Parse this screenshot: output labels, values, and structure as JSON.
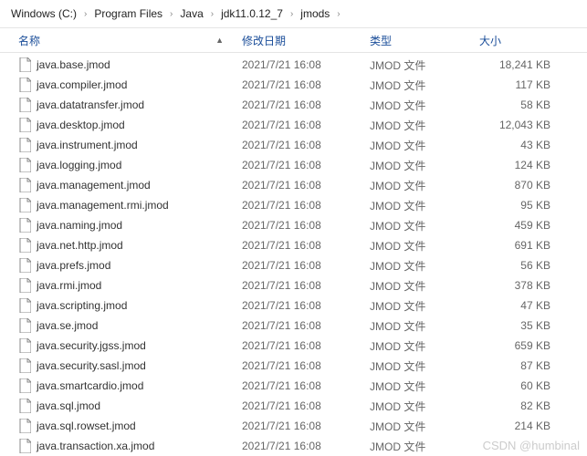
{
  "breadcrumb": {
    "items": [
      "Windows (C:)",
      "Program Files",
      "Java",
      "jdk11.0.12_7",
      "jmods"
    ]
  },
  "columns": {
    "name": "名称",
    "date": "修改日期",
    "type": "类型",
    "size": "大小"
  },
  "file_type_label": "JMOD 文件",
  "files": [
    {
      "name": "java.base.jmod",
      "date": "2021/7/21 16:08",
      "size": "18,241 KB"
    },
    {
      "name": "java.compiler.jmod",
      "date": "2021/7/21 16:08",
      "size": "117 KB"
    },
    {
      "name": "java.datatransfer.jmod",
      "date": "2021/7/21 16:08",
      "size": "58 KB"
    },
    {
      "name": "java.desktop.jmod",
      "date": "2021/7/21 16:08",
      "size": "12,043 KB"
    },
    {
      "name": "java.instrument.jmod",
      "date": "2021/7/21 16:08",
      "size": "43 KB"
    },
    {
      "name": "java.logging.jmod",
      "date": "2021/7/21 16:08",
      "size": "124 KB"
    },
    {
      "name": "java.management.jmod",
      "date": "2021/7/21 16:08",
      "size": "870 KB"
    },
    {
      "name": "java.management.rmi.jmod",
      "date": "2021/7/21 16:08",
      "size": "95 KB"
    },
    {
      "name": "java.naming.jmod",
      "date": "2021/7/21 16:08",
      "size": "459 KB"
    },
    {
      "name": "java.net.http.jmod",
      "date": "2021/7/21 16:08",
      "size": "691 KB"
    },
    {
      "name": "java.prefs.jmod",
      "date": "2021/7/21 16:08",
      "size": "56 KB"
    },
    {
      "name": "java.rmi.jmod",
      "date": "2021/7/21 16:08",
      "size": "378 KB"
    },
    {
      "name": "java.scripting.jmod",
      "date": "2021/7/21 16:08",
      "size": "47 KB"
    },
    {
      "name": "java.se.jmod",
      "date": "2021/7/21 16:08",
      "size": "35 KB"
    },
    {
      "name": "java.security.jgss.jmod",
      "date": "2021/7/21 16:08",
      "size": "659 KB"
    },
    {
      "name": "java.security.sasl.jmod",
      "date": "2021/7/21 16:08",
      "size": "87 KB"
    },
    {
      "name": "java.smartcardio.jmod",
      "date": "2021/7/21 16:08",
      "size": "60 KB"
    },
    {
      "name": "java.sql.jmod",
      "date": "2021/7/21 16:08",
      "size": "82 KB"
    },
    {
      "name": "java.sql.rowset.jmod",
      "date": "2021/7/21 16:08",
      "size": "214 KB"
    },
    {
      "name": "java.transaction.xa.jmod",
      "date": "2021/7/21 16:08",
      "size": ""
    }
  ],
  "watermark": "CSDN @humbinal"
}
